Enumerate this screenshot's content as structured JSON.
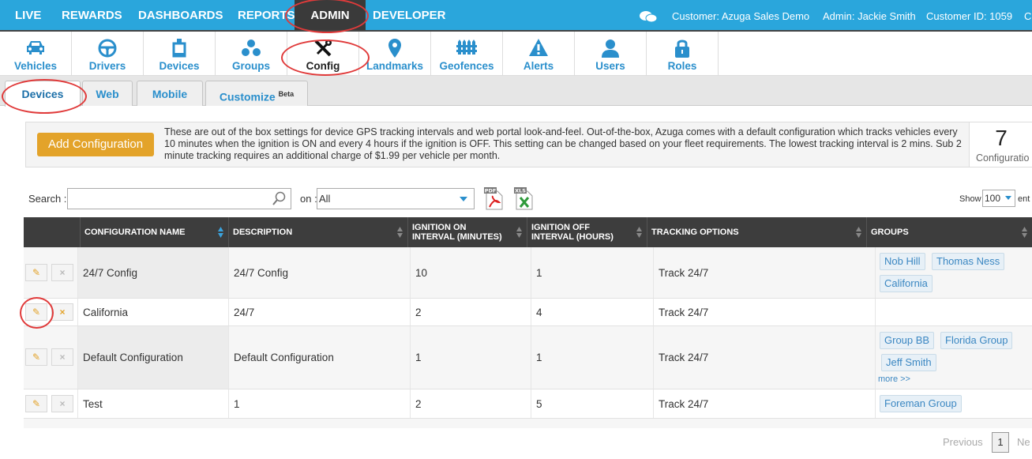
{
  "topnav": {
    "items": [
      "LIVE",
      "REWARDS",
      "DASHBOARDS",
      "REPORTS",
      "ADMIN",
      "DEVELOPER"
    ],
    "customer": "Customer: Azuga Sales Demo",
    "admin": "Admin: Jackie Smith",
    "customer_id": "Customer ID: 1059",
    "overflow_char": "C"
  },
  "toolbar": {
    "items": [
      "Vehicles",
      "Drivers",
      "Devices",
      "Groups",
      "Config",
      "Landmarks",
      "Geofences",
      "Alerts",
      "Users",
      "Roles"
    ],
    "active": "Config"
  },
  "subtabs": {
    "items": [
      "Devices",
      "Web",
      "Mobile",
      "Customize"
    ],
    "beta": "Beta"
  },
  "info": {
    "add_button": "Add Configuration",
    "text": "These are out of the box settings for device GPS tracking intervals and web portal look-and-feel. Out-of-the-box, Azuga comes with a default configuration which tracks vehicles every 10 minutes when the ignition is ON and every 4 hours if the ignition is OFF. This setting can be changed based on your fleet requirements. The lowest tracking interval is 2 mins. Sub 2 minute tracking requires an additional charge of $1.99 per vehicle per month.",
    "count": "7",
    "count_label": "Configuratio"
  },
  "search": {
    "label": "Search :",
    "value": "",
    "on_label": "on :",
    "on_value": "All",
    "pdf_label": "PDF",
    "xls_label": "XLS",
    "show_label": "Show",
    "show_value": "100",
    "entries_label": "ent"
  },
  "table": {
    "columns": [
      "CONFIGURATION NAME",
      "DESCRIPTION",
      "IGNITION ON INTERVAL (MINUTES)",
      "IGNITION OFF INTERVAL (HOURS)",
      "TRACKING OPTIONS",
      "GROUPS"
    ],
    "rows": [
      {
        "name": "24/7 Config",
        "description": "24/7 Config",
        "on": "10",
        "off": "1",
        "tracking": "Track 24/7",
        "groups": [
          "Nob Hill",
          "Thomas Ness",
          "California"
        ],
        "more": ""
      },
      {
        "name": "California",
        "description": "24/7",
        "on": "2",
        "off": "4",
        "tracking": "Track 24/7",
        "groups": [],
        "more": ""
      },
      {
        "name": "Default Configuration",
        "description": "Default Configuration",
        "on": "1",
        "off": "1",
        "tracking": "Track 24/7",
        "groups": [
          "Group BB",
          "Florida Group",
          "Jeff Smith"
        ],
        "more": "more >>"
      },
      {
        "name": "Test",
        "description": "1",
        "on": "2",
        "off": "5",
        "tracking": "Track 24/7",
        "groups": [
          "Foreman Group"
        ],
        "more": ""
      }
    ],
    "edit_icon": "pencil-icon",
    "delete_glyph": "×"
  },
  "pager": {
    "previous": "Previous",
    "page": "1",
    "next": "Ne"
  },
  "colors": {
    "nav": "#2aa6dc",
    "accent": "#e3a32a",
    "link": "#2a8fcc",
    "annotation": "#e03a3a"
  }
}
